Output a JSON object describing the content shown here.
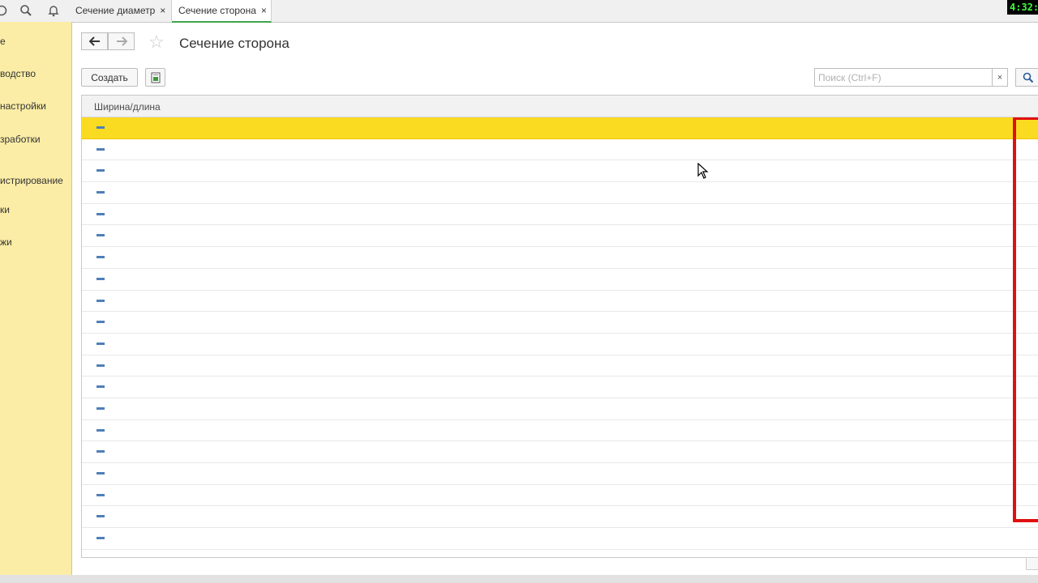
{
  "window": {
    "clock": "4:32:3",
    "tabs": [
      {
        "label": "Сечение диаметр",
        "active": false
      },
      {
        "label": "Сечение сторона",
        "active": true
      }
    ],
    "close_glyph": "×"
  },
  "sidebar": {
    "items": [
      {
        "label": "е"
      },
      {
        "label": "водство"
      },
      {
        "label": " настройки"
      },
      {
        "label": "зработки"
      },
      {
        "label": "истрирование"
      },
      {
        "label": "ки"
      },
      {
        "label": "жи"
      }
    ]
  },
  "form": {
    "title": "Сечение сторона",
    "create_label": "Создать",
    "search_placeholder": "Поиск (Ctrl+F)",
    "search_clear": "×"
  },
  "table": {
    "column_header": "Ширина/длина",
    "rows": [
      {
        "selected": true
      },
      {
        "selected": false
      },
      {
        "selected": false
      },
      {
        "selected": false
      },
      {
        "selected": false
      },
      {
        "selected": false
      },
      {
        "selected": false
      },
      {
        "selected": false
      },
      {
        "selected": false
      },
      {
        "selected": false
      },
      {
        "selected": false
      },
      {
        "selected": false
      },
      {
        "selected": false
      },
      {
        "selected": false
      },
      {
        "selected": false
      },
      {
        "selected": false
      },
      {
        "selected": false
      },
      {
        "selected": false
      },
      {
        "selected": false
      },
      {
        "selected": false
      }
    ]
  },
  "colors": {
    "sidebar_bg": "#fbeda6",
    "selected_row": "#fbdb22",
    "annotation_red": "#e01010",
    "active_tab_accent": "#3fa44b"
  },
  "icons": [
    "refresh-icon",
    "search-icon",
    "bell-icon",
    "back-arrow-icon",
    "forward-arrow-icon",
    "star-icon",
    "export-icon",
    "search-icon",
    "row-dash-icon",
    "mouse-cursor-icon"
  ]
}
